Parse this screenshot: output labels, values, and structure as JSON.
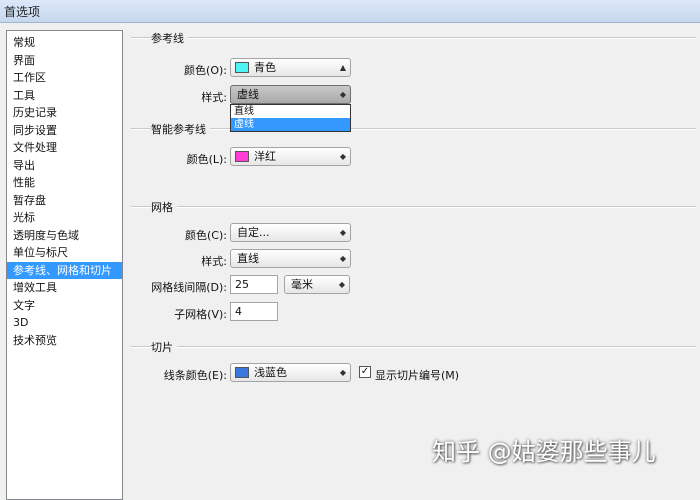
{
  "window": {
    "title": "首选项"
  },
  "sidebar": {
    "items": [
      {
        "label": "常规"
      },
      {
        "label": "界面"
      },
      {
        "label": "工作区"
      },
      {
        "label": "工具"
      },
      {
        "label": "历史记录"
      },
      {
        "label": "同步设置"
      },
      {
        "label": "文件处理"
      },
      {
        "label": "导出"
      },
      {
        "label": "性能"
      },
      {
        "label": "暂存盘"
      },
      {
        "label": "光标"
      },
      {
        "label": "透明度与色域"
      },
      {
        "label": "单位与标尺"
      },
      {
        "label": "参考线、网格和切片"
      },
      {
        "label": "增效工具"
      },
      {
        "label": "文字"
      },
      {
        "label": "3D"
      },
      {
        "label": "技术预览"
      }
    ],
    "selected_index": 13
  },
  "guides": {
    "title": "参考线",
    "color_label": "颜色(O):",
    "color_value": "青色",
    "color_hex": "#4ef3f3",
    "style_label": "样式:",
    "style_value": "虚线",
    "style_options": [
      "直线",
      "虚线"
    ],
    "style_highlight": 1
  },
  "smart_guides": {
    "title": "智能参考线",
    "color_label": "颜色(L):",
    "color_value": "洋红",
    "color_hex": "#ff3cd6"
  },
  "grid": {
    "title": "网格",
    "color_label": "颜色(C):",
    "color_value": "自定...",
    "style_label": "样式:",
    "style_value": "直线",
    "spacing_label": "网格线间隔(D):",
    "spacing_value": "25",
    "spacing_unit": "毫米",
    "subdiv_label": "子网格(V):",
    "subdiv_value": "4"
  },
  "slices": {
    "title": "切片",
    "line_color_label": "线条颜色(E):",
    "line_color_value": "浅蓝色",
    "line_color_hex": "#3a78e0",
    "show_numbers_label": "显示切片编号(M)",
    "show_numbers_mark": "✓"
  },
  "watermark": "知乎 @姑婆那些事儿"
}
